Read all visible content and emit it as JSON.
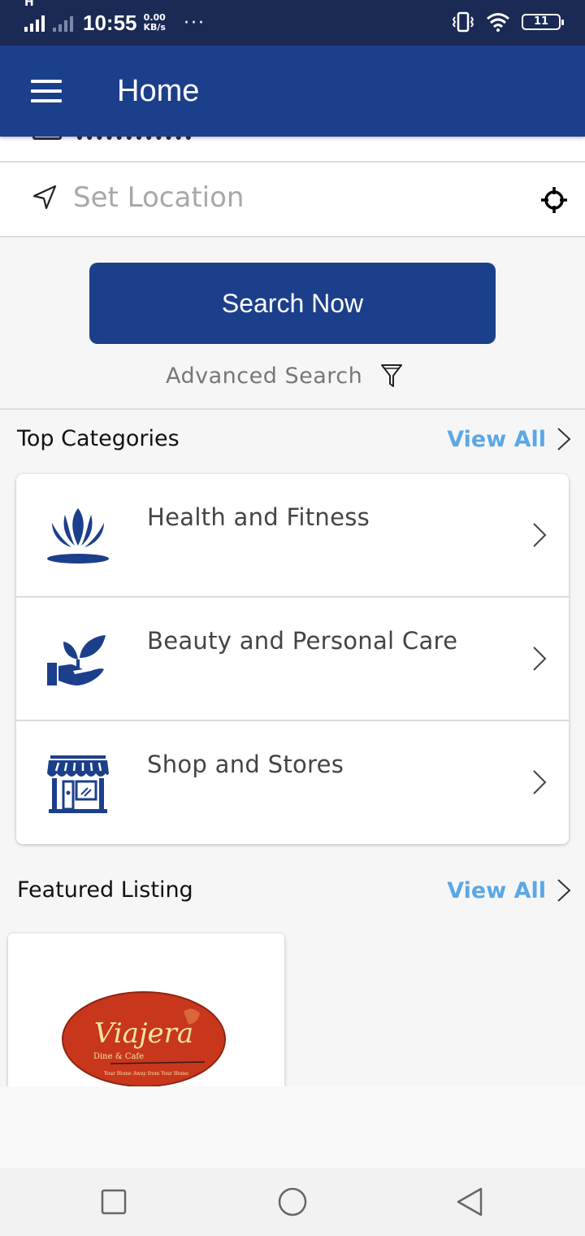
{
  "status_bar": {
    "network": "H",
    "time": "10:55",
    "speed_value": "0.00",
    "speed_unit": "KB/s",
    "more": "···",
    "battery": "11"
  },
  "app_bar": {
    "title": "Home",
    "background": "#1c3f8c"
  },
  "location": {
    "placeholder": "Set Location",
    "value": ""
  },
  "search": {
    "button_label": "Search Now",
    "advanced_label": "Advanced Search"
  },
  "top_categories": {
    "title": "Top Categories",
    "view_all": "View All",
    "items": [
      {
        "label": "Health and Fitness",
        "icon": "lotus-icon"
      },
      {
        "label": "Beauty and Personal Care",
        "icon": "hand-plant-icon"
      },
      {
        "label": "Shop and Stores",
        "icon": "storefront-icon"
      }
    ]
  },
  "featured": {
    "title": "Featured Listing",
    "view_all": "View All",
    "items": [
      {
        "logo_text": "Viajera",
        "logo_subtext": "Dine & Cafe",
        "logo_tagline": "Your Home Away from Your Home"
      }
    ]
  },
  "colors": {
    "primary": "#1c3f8c",
    "status_bar": "#1b2a55",
    "link": "#5aa8e6",
    "icon_blue": "#1c3f8c"
  }
}
